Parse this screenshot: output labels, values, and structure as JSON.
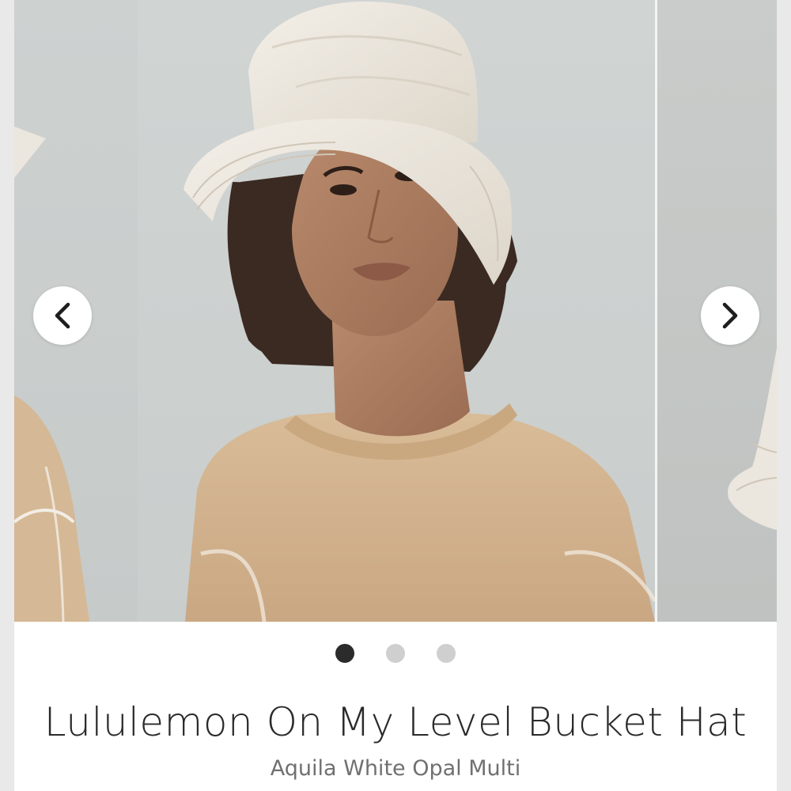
{
  "product": {
    "title": "Lululemon On My Level Bucket Hat",
    "color_name": "Aquila White Opal Multi"
  },
  "carousel": {
    "prev_icon": "chevron-left-icon",
    "next_icon": "chevron-right-icon",
    "slide_count": 3,
    "active_slide": 1
  },
  "colors": {
    "background": "#cfd3d2",
    "sweater": "#d2b491",
    "hat": "#ece6dc",
    "dot_active": "#2b2b2b",
    "dot_inactive": "#cfcfcf"
  }
}
